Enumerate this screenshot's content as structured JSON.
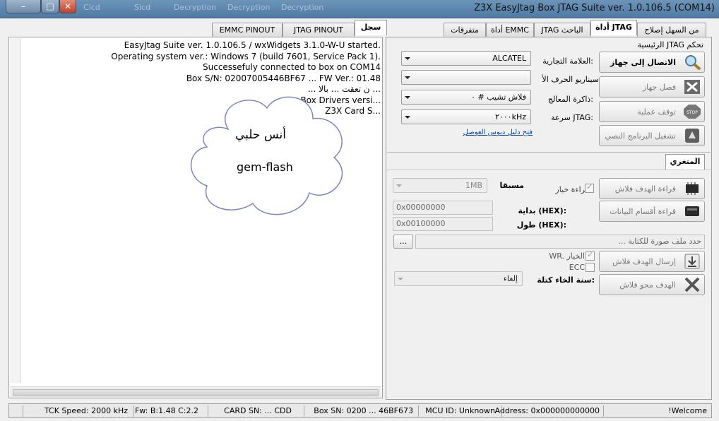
{
  "window": {
    "title": "Z3X EasyJtag Box JTAG Suite ver. 1.0.106.5 (COM14)",
    "background_menu": [
      "Cicd",
      "Sicd",
      "Decryption",
      "Decryption",
      "Decryption"
    ],
    "minimize_symbol": "–",
    "maximize_symbol": "□",
    "close_symbol": "✕"
  },
  "left_tabs": [
    "سجل",
    "JTAG PINOUT",
    "EMMC PINOUT"
  ],
  "log_lines": [
    "EasyJtag Suite ver. 1.0.106.5 / wxWidgets 3.1.0-W-U started.",
    "Operating system ver.: Windows 7 (build 7601, Service Pack 1).",
    "Successefuly connected to box on COM14",
    "Box S/N: 02007005446BF67 ... FW Ver.: 01.48",
    "... ن تعقت ... بالا ...",
    "Box Drivers versi...",
    "Z3X Card S..."
  ],
  "watermark": {
    "name": "أنس حلبي",
    "brand": "gem-flash"
  },
  "right_tabs": [
    "من السهل إصلاح",
    "أداة JTAG",
    "JTAG الباحث",
    "أداة EMMC",
    "متفرقات"
  ],
  "control": {
    "group_title": "الرئيسية JTAG تحكم",
    "buttons": {
      "connect": "الاتصال إلى جهاز",
      "disconnect": "فصل جهاز",
      "stop": "توقف عملية",
      "script": "تشغيل البرنامج النصي"
    },
    "brand_label": "العلامة التجارية:",
    "brand_value": "ALCATEL",
    "scenario_label": "سيناريو الحرف الأ",
    "scenario_value": "",
    "memory_label": "ذاكرة المعالج:",
    "memory_value": "فلاش تشيب # ٠",
    "speed_label": "سرعة JTAG:",
    "speed_value": "٢٠٠٠kHz",
    "guide_link": "فتح دليل ديوس العوصل"
  },
  "misc": {
    "tab_label": "المتغري",
    "read_flash": "قراءة الهدف فلاش",
    "read_partitions": "قراءة أقسام البيانات",
    "read_option_label": "قراءة خيار",
    "preset_label": "مسبقا",
    "preset_value": "1MB",
    "start_label": "بداية (HEX):",
    "start_value": "0x00000000",
    "length_label": "طول (HEX):",
    "length_value": "0x00100000",
    "image_placeholder": "حدد ملف صورة للكتابة ...",
    "browse": "...",
    "write_flash": "إرسال الهدف فلاش",
    "wr_option": "WR. الخيار",
    "ecc_option": "ECC",
    "erase_flash": "الهدف محو فلاش",
    "erase_mode_label": "سنة الخاء كتلة:",
    "erase_mode_value": "إلغاء"
  },
  "status": {
    "welcome": "!Welcome",
    "address": "Address: 0x000000000000",
    "mcu": "MCU ID: Unknown",
    "box_sn": "Box SN: 0200 ... 46BF673",
    "card_sn": "CARD SN: ... CDD",
    "fw": "Fw: B:1.48 C:2.2",
    "tck": "TCK Speed: 2000 kHz"
  },
  "colors": {
    "title_bar": "#5a85ad",
    "link": "#0645ad",
    "close": "#c9432d"
  }
}
